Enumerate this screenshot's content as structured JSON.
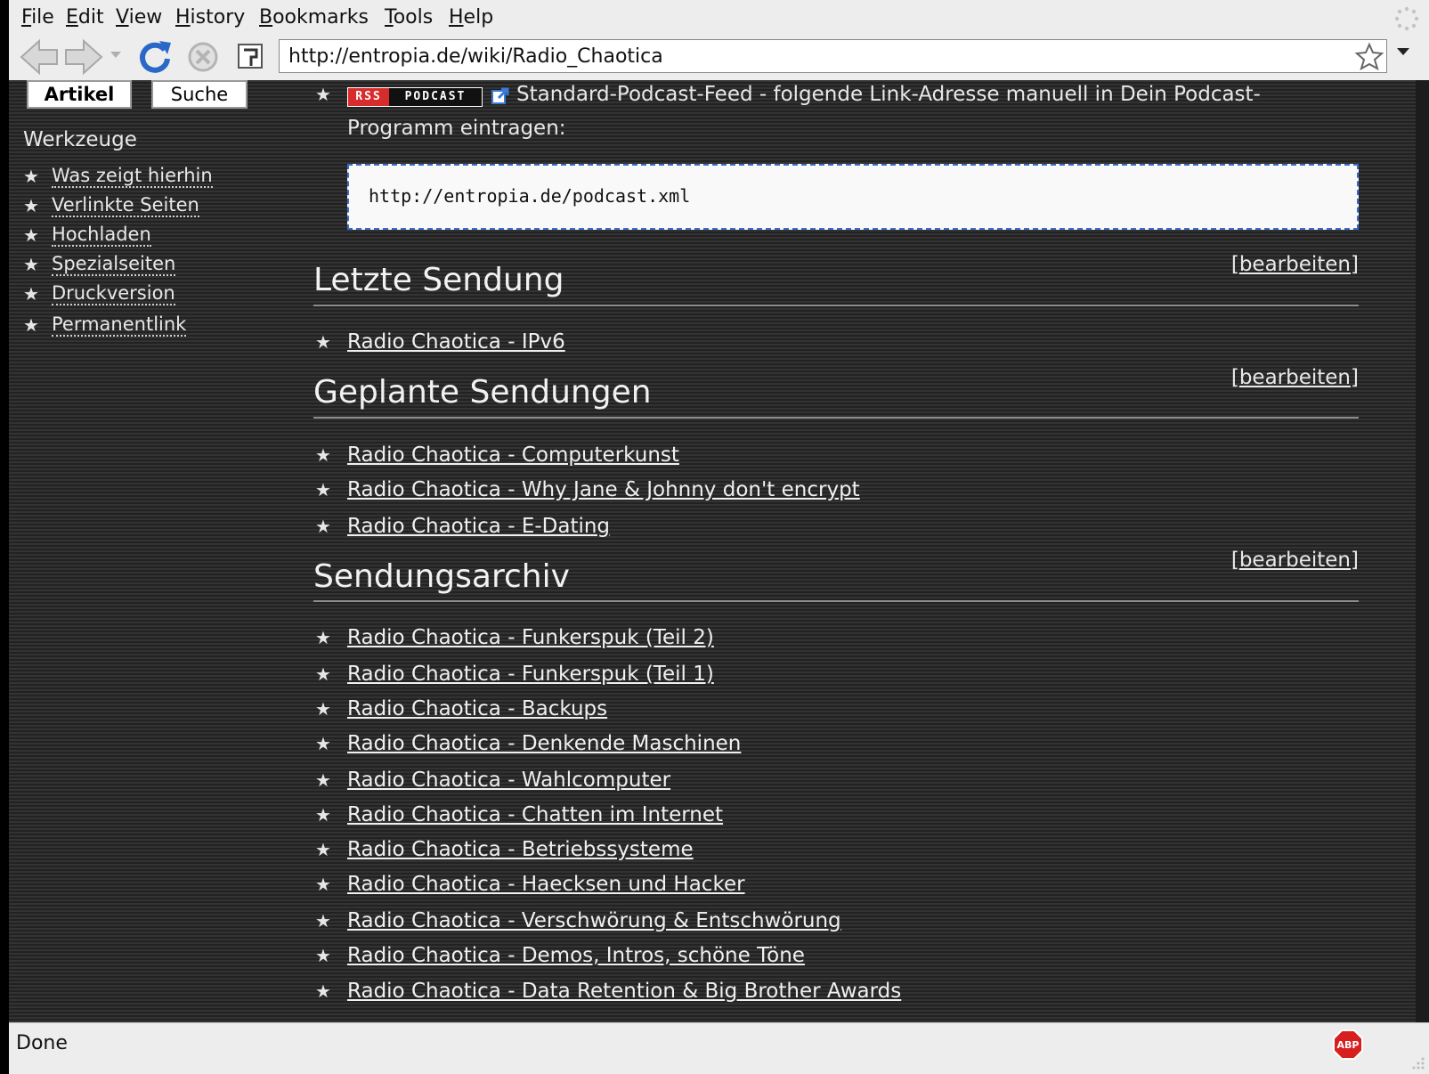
{
  "menu": [
    "File",
    "Edit",
    "View",
    "History",
    "Bookmarks",
    "Tools",
    "Help"
  ],
  "toolbar": {
    "back_icon": "back-arrow-icon",
    "forward_icon": "forward-arrow-icon",
    "reload_icon": "reload-icon",
    "stop_icon": "stop-icon",
    "url": "http://entropia.de/wiki/Radio_Chaotica"
  },
  "sidebar": {
    "tabs": [
      "Artikel",
      "Suche"
    ],
    "heading": "Werkzeuge",
    "items": [
      "Was zeigt hierhin",
      "Verlinkte Seiten",
      "Hochladen",
      "Spezialseiten",
      "Druckversion",
      "Permanentlink"
    ]
  },
  "content": {
    "rss_badge": {
      "left": "RSS",
      "right": "PODCAST"
    },
    "feed_line1": "Standard-Podcast-Feed - folgende Link-Adresse manuell in Dein Podcast-",
    "feed_line2": "Programm eintragen:",
    "feed_url": "http://entropia.de/podcast.xml",
    "edit_label": "bearbeiten",
    "sections": [
      {
        "title": "Letzte Sendung",
        "items": [
          "Radio Chaotica - IPv6"
        ]
      },
      {
        "title": "Geplante Sendungen",
        "items": [
          "Radio Chaotica - Computerkunst",
          "Radio Chaotica - Why Jane & Johnny don't encrypt",
          "Radio Chaotica - E-Dating"
        ]
      },
      {
        "title": "Sendungsarchiv",
        "items": [
          "Radio Chaotica - Funkerspuk (Teil 2)",
          "Radio Chaotica - Funkerspuk (Teil 1)",
          "Radio Chaotica - Backups",
          "Radio Chaotica - Denkende Maschinen",
          "Radio Chaotica - Wahlcomputer",
          "Radio Chaotica - Chatten im Internet",
          "Radio Chaotica - Betriebssysteme",
          "Radio Chaotica - Haecksen und Hacker",
          "Radio Chaotica - Verschwörung & Entschwörung",
          "Radio Chaotica - Demos, Intros, schöne Töne",
          "Radio Chaotica - Data Retention & Big Brother Awards"
        ]
      }
    ]
  },
  "status": {
    "text": "Done",
    "addon_icon": "adblock-plus-icon",
    "addon_label": "ABP"
  }
}
